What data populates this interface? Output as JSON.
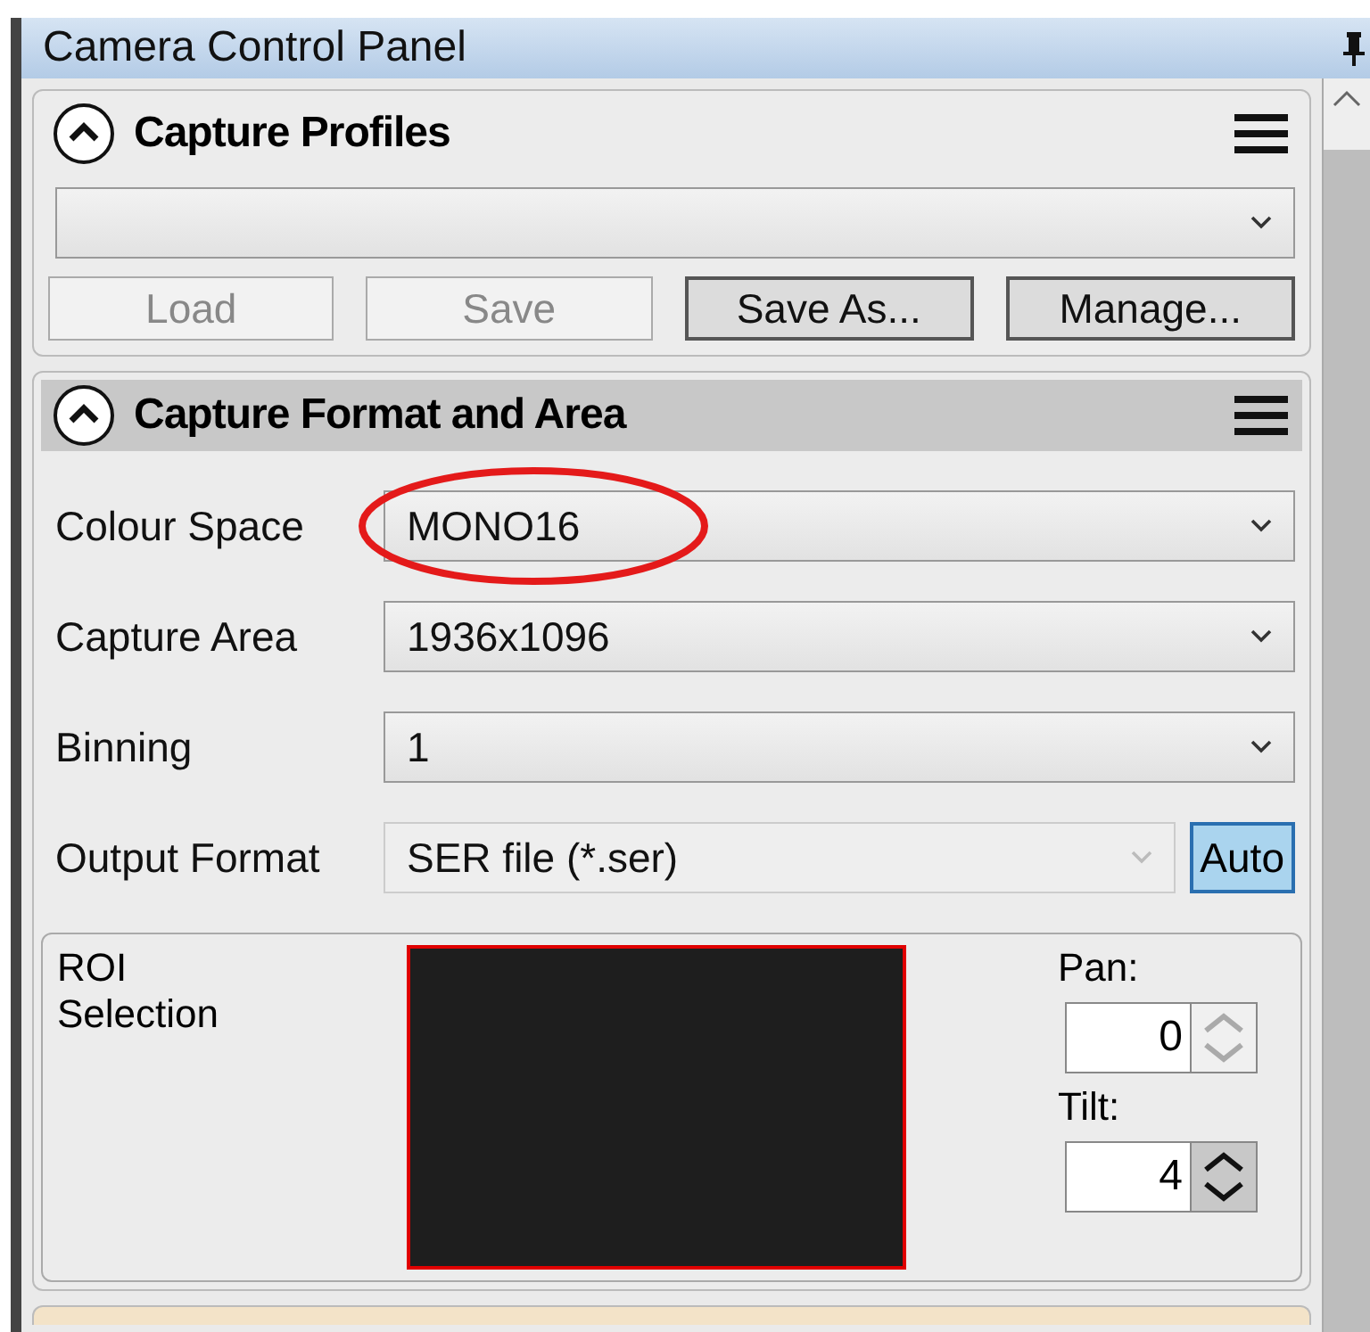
{
  "window": {
    "title": "Camera Control Panel"
  },
  "sections": [
    {
      "kind": "profiles",
      "title": "Capture Profiles",
      "expanded": true,
      "buttons": [
        {
          "label": "Load",
          "disabled": true
        },
        {
          "label": "Save",
          "disabled": true
        },
        {
          "label": "Save As...",
          "disabled": false
        },
        {
          "label": "Manage...",
          "disabled": false
        }
      ]
    },
    {
      "kind": "format",
      "title": "Capture Format and Area",
      "expanded": true,
      "fields": [
        {
          "label": "Colour Space",
          "value": "MONO16",
          "disabled": false,
          "circled": true
        },
        {
          "label": "Capture Area",
          "value": "1936x1096",
          "disabled": false,
          "circled": false
        },
        {
          "label": "Binning",
          "value": "1",
          "disabled": false,
          "circled": false
        },
        {
          "label": "Output Format",
          "value": "SER file (*.ser)",
          "disabled": true,
          "circled": false,
          "toggle": {
            "label": "Auto",
            "selected": true
          }
        }
      ],
      "roi": {
        "label": "ROI Selection",
        "spinners": [
          {
            "label": "Pan:",
            "value": "0",
            "disabled": true
          },
          {
            "label": "Tilt:",
            "value": "4",
            "disabled": false
          }
        ]
      }
    }
  ]
}
